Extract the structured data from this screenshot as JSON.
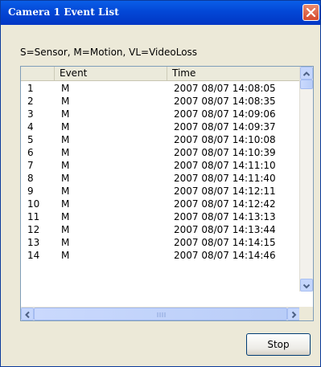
{
  "window": {
    "title": "Camera 1  Event List"
  },
  "legend": "S=Sensor, M=Motion, VL=VideoLoss",
  "columns": {
    "number": "",
    "event": "Event",
    "time": "Time"
  },
  "rows": [
    {
      "no": "1",
      "event": "M",
      "time": "2007 08/07 14:08:05"
    },
    {
      "no": "2",
      "event": "M",
      "time": "2007 08/07 14:08:35"
    },
    {
      "no": "3",
      "event": "M",
      "time": "2007 08/07 14:09:06"
    },
    {
      "no": "4",
      "event": "M",
      "time": "2007 08/07 14:09:37"
    },
    {
      "no": "5",
      "event": "M",
      "time": "2007 08/07 14:10:08"
    },
    {
      "no": "6",
      "event": "M",
      "time": "2007 08/07 14:10:39"
    },
    {
      "no": "7",
      "event": "M",
      "time": "2007 08/07 14:11:10"
    },
    {
      "no": "8",
      "event": "M",
      "time": "2007 08/07 14:11:40"
    },
    {
      "no": "9",
      "event": "M",
      "time": "2007 08/07 14:12:11"
    },
    {
      "no": "10",
      "event": "M",
      "time": "2007 08/07 14:12:42"
    },
    {
      "no": "11",
      "event": "M",
      "time": "2007 08/07 14:13:13"
    },
    {
      "no": "12",
      "event": "M",
      "time": "2007 08/07 14:13:44"
    },
    {
      "no": "13",
      "event": "M",
      "time": "2007 08/07 14:14:15"
    },
    {
      "no": "14",
      "event": "M",
      "time": "2007 08/07 14:14:46"
    }
  ],
  "buttons": {
    "stop": "Stop"
  },
  "icons": {
    "close": "close-icon",
    "scroll_up": "arrow-up-icon",
    "scroll_down": "arrow-down-icon",
    "scroll_left": "arrow-left-icon",
    "scroll_right": "arrow-right-icon"
  },
  "colors": {
    "title_bar": "#0347d6",
    "close_button": "#d7492d",
    "dialog_bg": "#ece9d8"
  }
}
